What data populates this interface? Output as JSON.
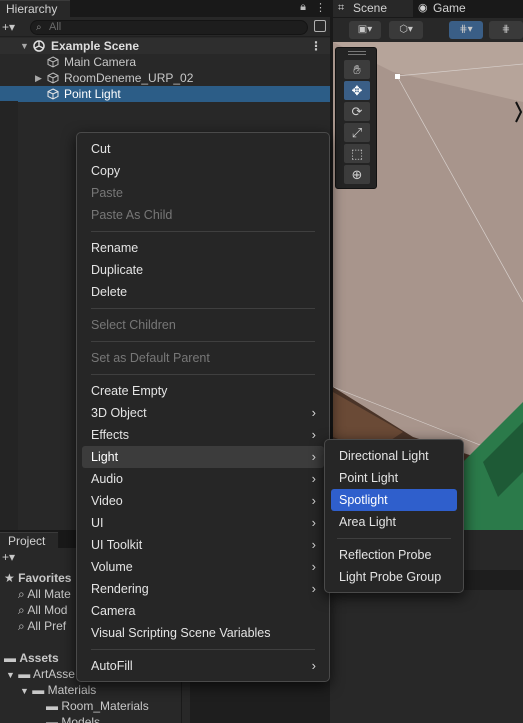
{
  "hierarchy": {
    "tab_label": "Hierarchy",
    "search_placeholder": "All",
    "scene_name": "Example Scene",
    "items": [
      {
        "label": "Main Camera"
      },
      {
        "label": "RoomDeneme_URP_02"
      },
      {
        "label": "Point Light"
      }
    ]
  },
  "scene_view": {
    "tabs": [
      {
        "label": "Scene"
      },
      {
        "label": "Game"
      }
    ]
  },
  "project": {
    "tab_label": "Project",
    "tree": [
      {
        "label": "Favorites"
      },
      {
        "label": "All Mate"
      },
      {
        "label": "All Mod"
      },
      {
        "label": "All Pref"
      },
      {
        "label": "Assets"
      },
      {
        "label": "ArtAsse"
      },
      {
        "label": "Materials"
      },
      {
        "label": "Room_Materials"
      },
      {
        "label": "Models"
      }
    ]
  },
  "context_menu": {
    "items": [
      {
        "label": "Cut",
        "enabled": true
      },
      {
        "label": "Copy",
        "enabled": true
      },
      {
        "label": "Paste",
        "enabled": false
      },
      {
        "label": "Paste As Child",
        "enabled": false
      },
      {
        "label": "Rename",
        "enabled": true
      },
      {
        "label": "Duplicate",
        "enabled": true
      },
      {
        "label": "Delete",
        "enabled": true
      },
      {
        "label": "Select Children",
        "enabled": false
      },
      {
        "label": "Set as Default Parent",
        "enabled": false
      },
      {
        "label": "Create Empty",
        "enabled": true
      },
      {
        "label": "3D Object",
        "enabled": true,
        "submenu": true
      },
      {
        "label": "Effects",
        "enabled": true,
        "submenu": true
      },
      {
        "label": "Light",
        "enabled": true,
        "submenu": true,
        "active": true
      },
      {
        "label": "Audio",
        "enabled": true,
        "submenu": true
      },
      {
        "label": "Video",
        "enabled": true,
        "submenu": true
      },
      {
        "label": "UI",
        "enabled": true,
        "submenu": true
      },
      {
        "label": "UI Toolkit",
        "enabled": true,
        "submenu": true
      },
      {
        "label": "Volume",
        "enabled": true,
        "submenu": true
      },
      {
        "label": "Rendering",
        "enabled": true,
        "submenu": true
      },
      {
        "label": "Camera",
        "enabled": true
      },
      {
        "label": "Visual Scripting Scene Variables",
        "enabled": true
      },
      {
        "label": "AutoFill",
        "enabled": true,
        "submenu": true
      }
    ]
  },
  "light_submenu": {
    "items": [
      {
        "label": "Directional Light"
      },
      {
        "label": "Point Light"
      },
      {
        "label": "Spotlight",
        "highlighted": true
      },
      {
        "label": "Area Light"
      },
      {
        "label": "Reflection Probe"
      },
      {
        "label": "Light Probe Group"
      }
    ]
  },
  "colors": {
    "selection_blue": "#2c5d87",
    "menu_highlight": "#2f5fcc",
    "menu_bg": "#262626",
    "panel_bg": "#282828",
    "floor_green": "#2b7a4a",
    "wall": "#a8958c"
  }
}
